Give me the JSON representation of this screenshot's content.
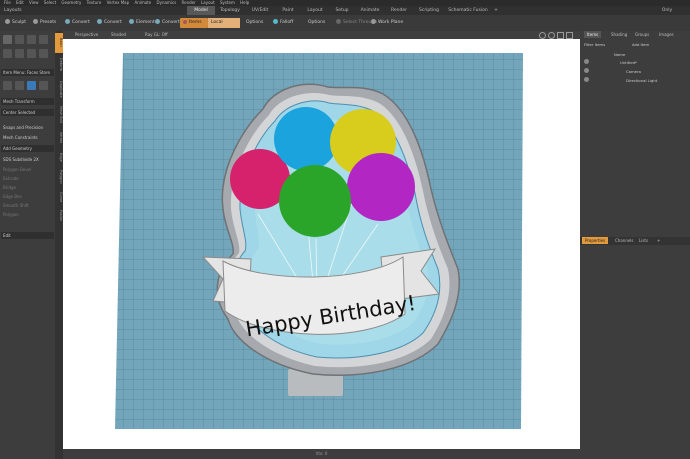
{
  "menubar": {
    "items": [
      "File",
      "Edit",
      "View",
      "Select",
      "Geometry",
      "Texture",
      "Vertex Map",
      "Animate",
      "Dynamics",
      "Render",
      "Layout",
      "System",
      "Help"
    ]
  },
  "tabs": {
    "left_label": "Layouts",
    "items": [
      "Model",
      "Topology",
      "UV/Edit",
      "Paint",
      "Layout",
      "Setup",
      "Animate",
      "Render",
      "Scripting",
      "Schematic Fusion"
    ],
    "plus": "+",
    "right_label": "Only"
  },
  "toolbar": {
    "sculpt": "Sculpt",
    "presets": "Presets",
    "convert1": "Convert",
    "convert2": "Convert",
    "element": "Element",
    "convert3": "Convert",
    "items": "Items",
    "local": "Local",
    "options1": "Options",
    "falloff": "Falloff",
    "options2": "Options",
    "select_through": "Select Through",
    "work_plane": "Work Plane"
  },
  "left": {
    "item_menu": "Item Menu: Faces Store",
    "mesh_transform": "Mesh Transform",
    "center_selected": "Center Selected",
    "snaps": "Snaps and Precision",
    "mesh_constraints": "Mesh Constraints",
    "add_geometry": "Add Geometry",
    "subdivide": "SDS Subdivide 2X",
    "disabled_rows": [
      "Polygon Bevel",
      "Extrude",
      "Bridge",
      "Edge Bev",
      "Smooth Shift",
      "Polygon"
    ],
    "edit": "Edit",
    "vtabs": [
      "Basic",
      "Deform",
      "Duplicate",
      "Mesh Edit",
      "Vertex",
      "Edge",
      "Polygon",
      "Curve",
      "Fusion"
    ]
  },
  "viewport": {
    "perspective": "Perspective",
    "shaded": "Shaded",
    "ray_gl": "Ray GL: Off",
    "status": "Vtx: 0"
  },
  "cookie": {
    "text": "Happy Birthday!",
    "balloon_colors": [
      "#d6216c",
      "#1aa3dc",
      "#d8cc1c",
      "#b227c4",
      "#2aa52a"
    ]
  },
  "right": {
    "tabs": [
      "Items",
      "Shading",
      "Groups",
      "Images"
    ],
    "filter": "Filter Items",
    "add_item": "Add Item",
    "name_col": "Name",
    "tree": [
      "Untitled*",
      "Camera",
      "Directional Light"
    ],
    "bottom_tabs": [
      "Properties",
      "Channels",
      "Lists"
    ],
    "bottom_plus": "+"
  }
}
